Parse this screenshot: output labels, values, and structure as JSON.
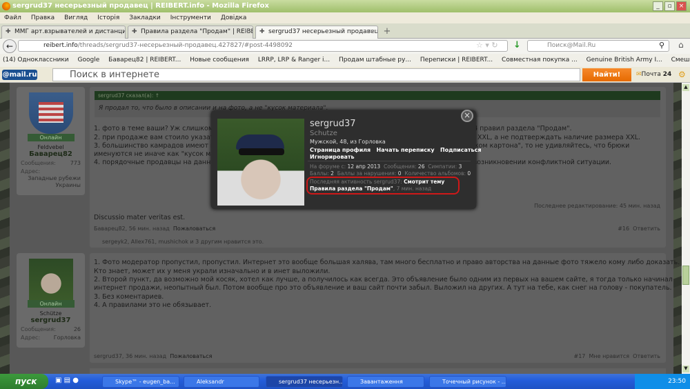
{
  "window": {
    "title": "sergrud37 несерьезный продавец | REIBERT.info - Mozilla Firefox"
  },
  "menu": [
    "Файл",
    "Правка",
    "Вигляд",
    "Історія",
    "Закладки",
    "Інструменти",
    "Довідка"
  ],
  "tabs": [
    {
      "label": "ММГ арт.взрывателей и дистанционн..."
    },
    {
      "label": "Правила раздела \"Продам\" | REIBERT.i..."
    },
    {
      "label": "sergrud37 несерьезный продавец | REI..."
    }
  ],
  "nav": {
    "url_domain": "reibert.info",
    "url_path": "/threads/sergrud37-несерьезный-продавец.427827/#post-4498092",
    "search_placeholder": "Поиск@Mail.Ru"
  },
  "bookmarks": [
    "(14) Одноклассники",
    "Google",
    "Баварец82 | REIBERT...",
    "Новые сообщения",
    "LRRP, LRP & Ranger i...",
    "Продам штабные ру...",
    "Переписки | REIBERT...",
    "Совместная покупка ...",
    "Genuine British Army I...",
    "Смешные истории из..."
  ],
  "mailbar": {
    "logo": "@mail.ru",
    "placeholder": "Поиск в интернете",
    "find": "Найти!",
    "mail": "Почта",
    "mail_count": "24"
  },
  "post1": {
    "user": {
      "rank": "Feldvebel",
      "name": "Баварец82",
      "online": "Онлайн",
      "posts_label": "Сообщения:",
      "posts": "773",
      "addr_label": "Адрес:",
      "addr1": "Западные рубежи",
      "addr2": "Украины"
    },
    "quote_header": "sergrud37 сказал(а): ↑",
    "quote": "Я продал то, что было в описании и на фото, а не \"кусок материала\".",
    "lines_left": [
      "1. фото в теме ваши? Уж слишком о",
      "2. при продаже вам стоило указать",
      "3. большинство камрадов имеют пр",
      "именуются не иначе как \"кусок мат",
      "4. порядочные продавцы на данном"
    ],
    "lines_right": [
      "3,4 правил раздела \"Продам\".",
      "на XXL, а не подтверждать наличие размера XXL.",
      "уском картона\", то не удивляйтесь, что брюки",
      "",
      "в возникновении конфликтной ситуации."
    ],
    "edited": "Последнее редактирование: 45 мин. назад",
    "signature": "Discussio mater veritas est.",
    "meta": "Баварец82, 56 мин. назад",
    "report": "Пожаловаться",
    "num": "#16",
    "reply": "Ответить",
    "likes": "sergeyk2, Allex761, mushichok и 3 другим нравится это."
  },
  "post2": {
    "user": {
      "rank": "Schütze",
      "name": "sergrud37",
      "online": "Онлайн",
      "posts_label": "Сообщения:",
      "posts": "26",
      "addr_label": "Адрес:",
      "addr": "Горловка"
    },
    "lines": [
      "1. Фото модератор пропустил, пропустил. Интернет это вообще большая халява, там много бесплатно и право авторства на данные фото тяжело кому либо доказать.",
      "Кто знает, может их у меня украли изначально и в инет выложили.",
      "2. Второй пункт, да возможно мой косяк, хотел как лучше, а получилось как всегда. Это объявление было одним из первых на вашем сайте, я тогда только начинал",
      "интернет продажи, неопытный был. Потом вообще про это объявление и ваш сайт почти забыл. Выложил на других. А тут на тебе, как снег на голову - покупатель.",
      "3. Без коментариев.",
      "4. А правилами это не обязывает."
    ],
    "meta": "sergrud37, 36 мин. назад",
    "report": "Пожаловаться",
    "num": "#17",
    "like": "Мне нравится",
    "reply": "Ответить"
  },
  "popup": {
    "name": "sergrud37",
    "title": "Schutze",
    "info": "Мужской, 48, из Горловка",
    "links": [
      "Страница профиля",
      "Начать переписку",
      "Подписаться",
      "Игнорировать"
    ],
    "stats1": [
      {
        "label": "На форуме с:",
        "value": "12 апр 2013"
      },
      {
        "label": "Сообщения:",
        "value": "26"
      },
      {
        "label": "Симпатии:",
        "value": "3"
      }
    ],
    "stats2": [
      {
        "label": "Баллы:",
        "value": "2"
      },
      {
        "label": "Баллы за нарушения:",
        "value": "0"
      },
      {
        "label": "Количество альбомов:",
        "value": "0"
      }
    ],
    "activity_label": "Последняя активность sergrud37:",
    "activity": "Смотрит тему Правила раздела \"Продам\"",
    "activity_time": ", 7 мин. назад"
  },
  "taskbar": {
    "start": "пуск",
    "tasks": [
      "Skype™ - eugen_ba...",
      "Aleksandr",
      "sergrud37 несерьезн...",
      "Завантаження",
      "Точечный рисунок - ..."
    ],
    "clock": "23:50"
  }
}
